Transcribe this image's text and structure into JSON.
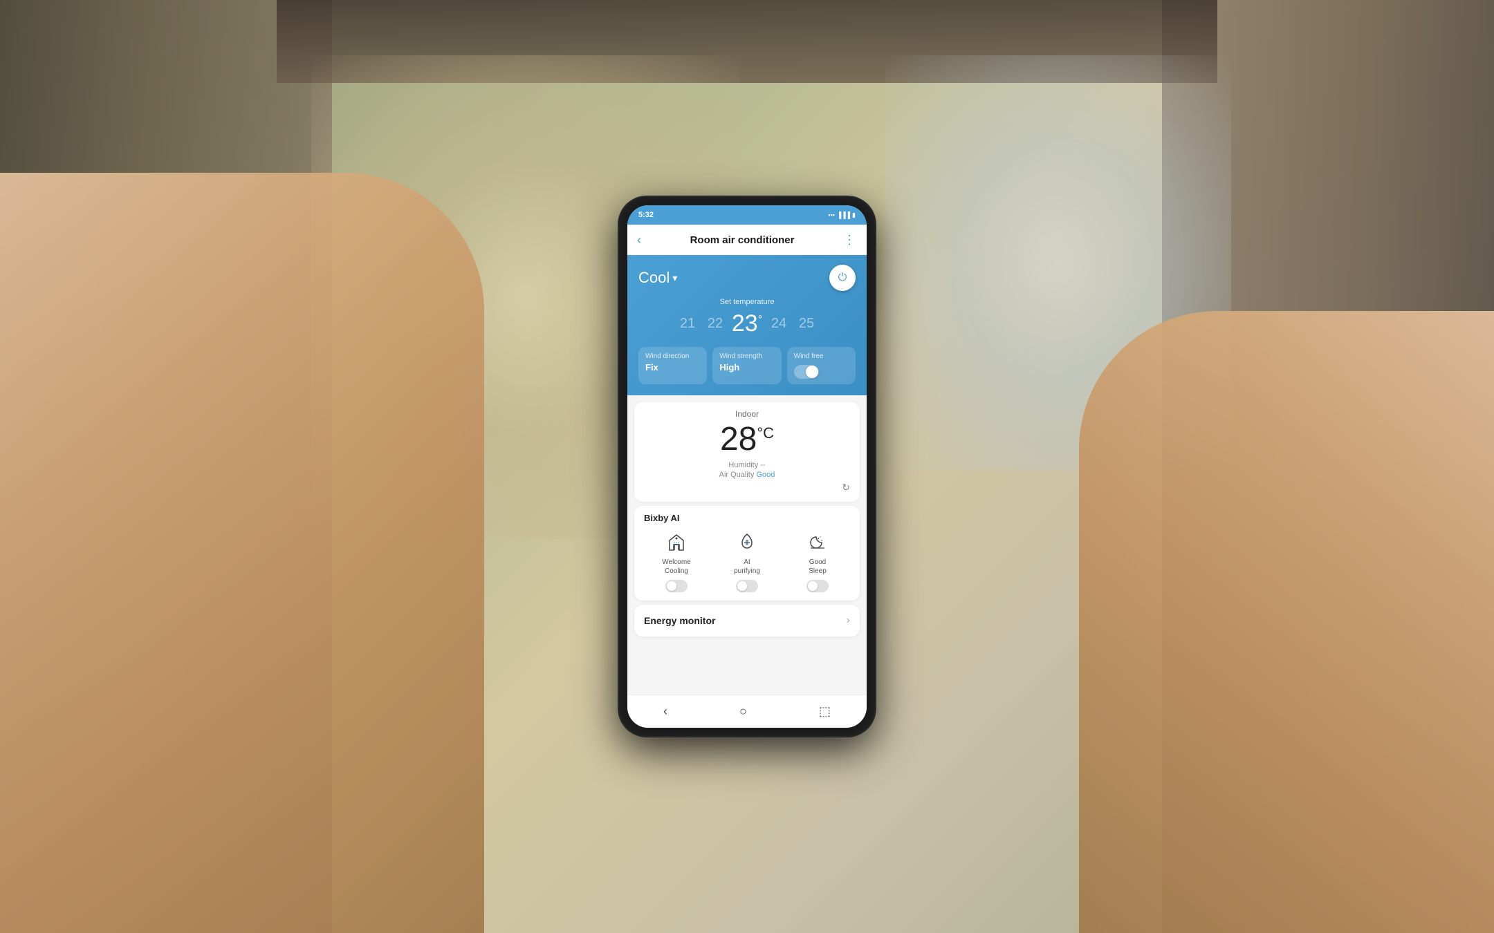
{
  "background": {
    "color": "#8a9070"
  },
  "phone": {
    "status_bar": {
      "time": "5:32",
      "icons": "📶 🔋"
    },
    "top_bar": {
      "title": "Room air conditioner",
      "back_label": "‹",
      "menu_label": "⋮"
    },
    "blue_panel": {
      "mode": "Cool",
      "dropdown_icon": "▾",
      "power_icon": "⏻",
      "set_temp_label": "Set temperature",
      "temperatures": [
        {
          "value": "21",
          "active": false
        },
        {
          "value": "22",
          "active": false
        },
        {
          "value": "23",
          "active": true
        },
        {
          "value": "24",
          "active": false
        },
        {
          "value": "25",
          "active": false
        }
      ],
      "temp_degree": "°",
      "controls": {
        "wind_direction": {
          "label": "Wind direction",
          "value": "Fix"
        },
        "wind_strength": {
          "label": "Wind strength",
          "value": "High"
        },
        "wind_free": {
          "label": "Wind free"
        }
      }
    },
    "indoor": {
      "title": "Indoor",
      "temperature": "28",
      "temp_unit": "°C",
      "humidity": "Humidity --",
      "air_quality_label": "Air Quality",
      "air_quality_value": "Good"
    },
    "bixby": {
      "title": "Bixby AI",
      "items": [
        {
          "label": "Welcome\nCooling",
          "icon": "house"
        },
        {
          "label": "AI\npurifying",
          "icon": "leaf"
        },
        {
          "label": "Good\nSleep",
          "icon": "moon"
        }
      ]
    },
    "energy_monitor": {
      "label": "Energy monitor",
      "arrow": "›"
    },
    "nav": {
      "back": "‹",
      "home": "○",
      "recent": "⬚"
    }
  }
}
